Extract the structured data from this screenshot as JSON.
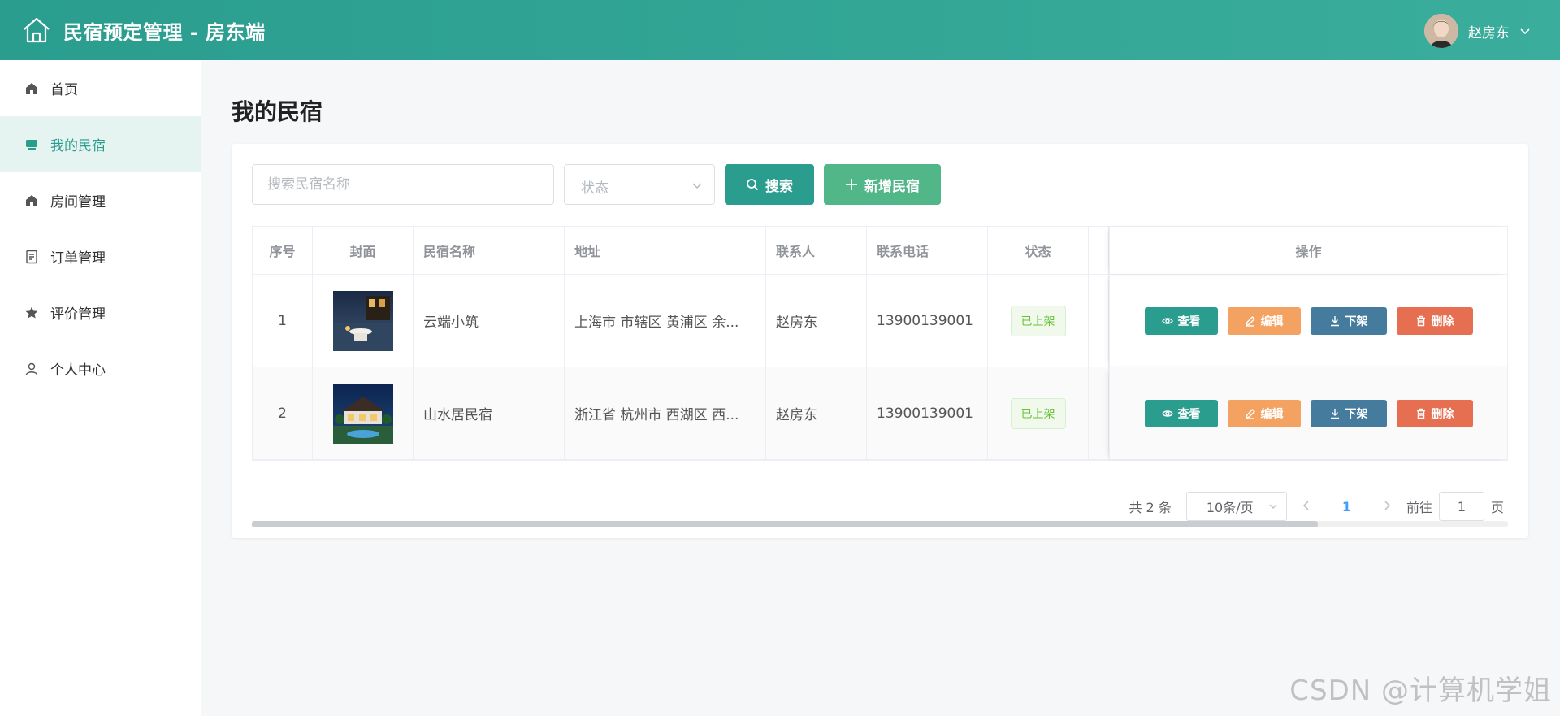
{
  "header": {
    "title": "民宿预定管理 - 房东端",
    "user_name": "赵房东"
  },
  "sidebar": {
    "items": [
      {
        "label": "首页",
        "icon": "home-icon"
      },
      {
        "label": "我的民宿",
        "icon": "house-card-icon",
        "active": true
      },
      {
        "label": "房间管理",
        "icon": "home-icon"
      },
      {
        "label": "订单管理",
        "icon": "document-icon"
      },
      {
        "label": "评价管理",
        "icon": "star-icon"
      },
      {
        "label": "个人中心",
        "icon": "user-icon"
      }
    ]
  },
  "page": {
    "title": "我的民宿"
  },
  "filters": {
    "search_placeholder": "搜索民宿名称",
    "status_placeholder": "状态",
    "search_button": "搜索",
    "add_button": "新增民宿"
  },
  "table": {
    "columns": [
      "序号",
      "封面",
      "民宿名称",
      "地址",
      "联系人",
      "联系电话",
      "状态",
      "操作"
    ],
    "rows": [
      {
        "index": "1",
        "name": "云端小筑",
        "address": "上海市 市辖区 黄浦区 余...",
        "contact": "赵房东",
        "phone": "13900139001",
        "status": "已上架"
      },
      {
        "index": "2",
        "name": "山水居民宿",
        "address": "浙江省 杭州市 西湖区 西...",
        "contact": "赵房东",
        "phone": "13900139001",
        "status": "已上架"
      }
    ],
    "actions": {
      "view": "查看",
      "edit": "编辑",
      "down": "下架",
      "delete": "删除"
    }
  },
  "pagination": {
    "total": "共 2 条",
    "page_size": "10条/页",
    "current_page": "1",
    "goto_label": "前往",
    "goto_value": "1",
    "page_unit": "页"
  },
  "watermark": "CSDN @计算机学姐",
  "colors": {
    "primary": "#2a9d8f",
    "add": "#52b788",
    "edit": "#f4a261",
    "down": "#457b9d",
    "delete": "#e76f51"
  }
}
